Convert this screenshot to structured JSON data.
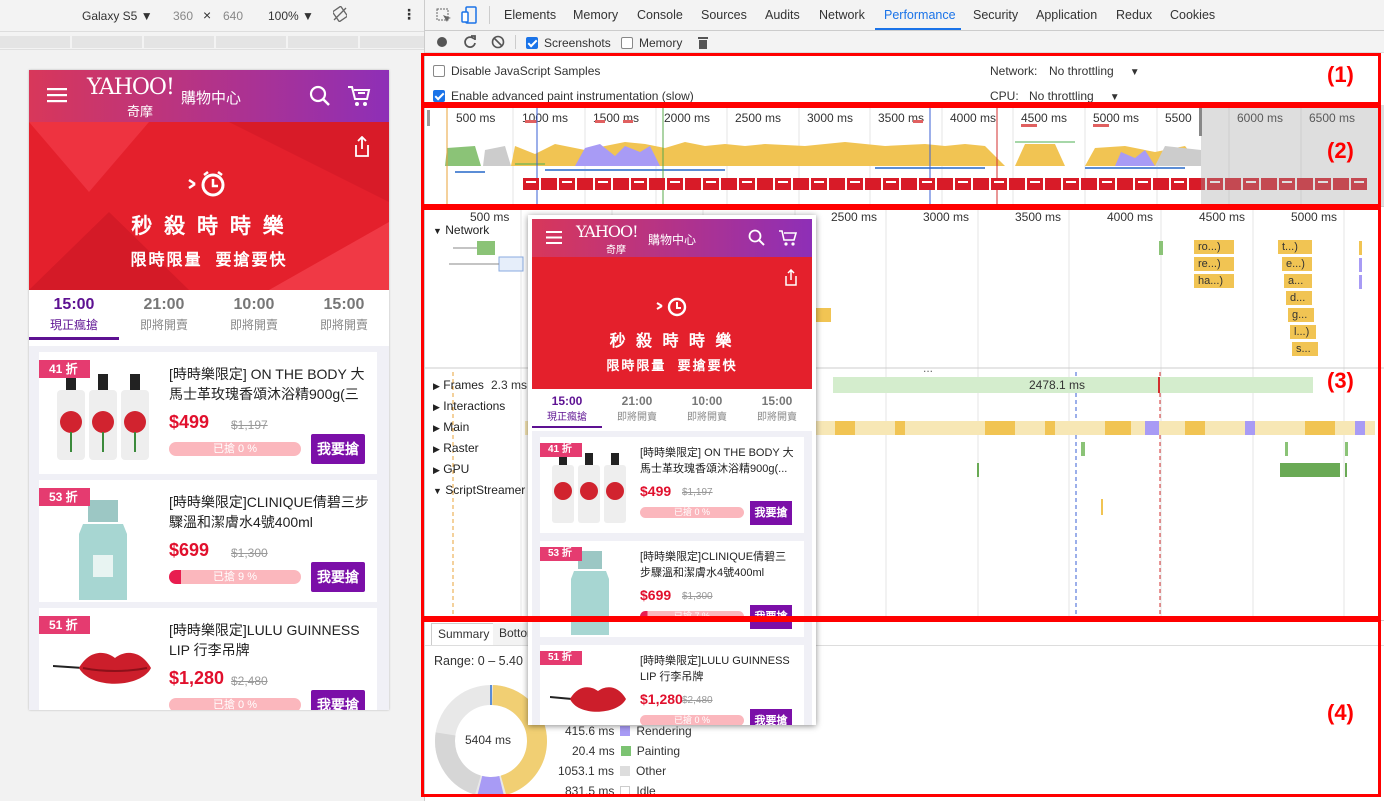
{
  "device_toolbar": {
    "device": "Galaxy S5 ▼",
    "width": "360",
    "x": "×",
    "height": "640",
    "zoom": "100% ▼"
  },
  "devtools_tabs": [
    "Elements",
    "Memory",
    "Console",
    "Sources",
    "Audits",
    "Network",
    "Performance",
    "Security",
    "Application",
    "Redux",
    "Cookies"
  ],
  "active_tab": "Performance",
  "perf_toolbar": {
    "screenshots_label": "Screenshots",
    "memory_label": "Memory"
  },
  "settings": {
    "disable_js_samples": "Disable JavaScript Samples",
    "advanced_paint": "Enable advanced paint instrumentation (slow)",
    "network_label": "Network:",
    "network_value": "No throttling",
    "cpu_label": "CPU:",
    "cpu_value": "No throttling"
  },
  "overview_ticks": [
    "500 ms",
    "1000 ms",
    "1500 ms",
    "2000 ms",
    "2500 ms",
    "3000 ms",
    "3500 ms",
    "4000 ms",
    "4500 ms",
    "5000 ms",
    "5500",
    "6000 ms",
    "6500 ms"
  ],
  "flame_ticks": [
    "500 ms",
    "1000 ms",
    "1500 ms",
    "2000 ms",
    "2500 ms",
    "3000 ms",
    "3500 ms",
    "4000 ms",
    "4500 ms",
    "5000 ms"
  ],
  "tracks": {
    "network": "Network",
    "frames": "Frames",
    "interactions": "Interactions",
    "main": "Main",
    "raster": "Raster",
    "gpu": "GPU",
    "scriptstreamer": "ScriptStreamer"
  },
  "frames_values": {
    "first": "2.3 ms",
    "second": "2478.1 ms"
  },
  "network_items": [
    "ro...)",
    "re...)",
    "ha...)",
    "t...)",
    "e...)",
    "a...",
    "d...",
    "g...",
    "l...)",
    "s..."
  ],
  "bottom": {
    "tabs": [
      "Summary",
      "Bottom-Up"
    ],
    "range": "Range: 0 – 5.40",
    "donut_total": "5404 ms",
    "legend": [
      {
        "value": "415.6 ms",
        "label": "Rendering",
        "color": "#a89bf5"
      },
      {
        "value": "20.4 ms",
        "label": "Painting",
        "color": "#7cc372"
      },
      {
        "value": "1053.1 ms",
        "label": "Other",
        "color": "#dddddd"
      },
      {
        "value": "831.5 ms",
        "label": "Idle",
        "color": "#ffffff"
      }
    ]
  },
  "annotations": [
    "(1)",
    "(2)",
    "(3)",
    "(4)"
  ],
  "phone": {
    "logo": "YAHOO!",
    "logo_sub": "奇摩",
    "store": "購物中心",
    "banner_title": "秒 殺 時 時 樂",
    "banner_sub": "限時限量  要搶要快",
    "tabs": [
      {
        "time": "15:00",
        "status": "現正瘋搶",
        "active": true
      },
      {
        "time": "21:00",
        "status": "即將開賣"
      },
      {
        "time": "10:00",
        "status": "即將開賣"
      },
      {
        "time": "15:00",
        "status": "即將開賣"
      }
    ],
    "products": [
      {
        "discount": "41 折",
        "title": "[時時樂限定] ON THE BODY 大馬士革玫瑰香頌沐浴精900g(三",
        "price": "$499",
        "orig": "$1,197",
        "sold": "已搶 0 %",
        "buy": "我要搶"
      },
      {
        "discount": "53 折",
        "title": "[時時樂限定]CLINIQUE倩碧三步驟溫和潔膚水4號400ml",
        "price": "$699",
        "orig": "$1,300",
        "sold": "已搶 9 %",
        "buy": "我要搶"
      },
      {
        "discount": "51 折",
        "title": "[時時樂限定]LULU GUINNESS LIP 行李吊牌",
        "price": "$1,280",
        "orig": "$2,480",
        "sold": "已搶 0 %",
        "buy": "我要搶"
      }
    ]
  },
  "popup": {
    "products": [
      {
        "discount": "41 折",
        "title": "[時時樂限定] ON THE BODY 大馬士革玫瑰香頌沐浴精900g(...",
        "price": "$499",
        "orig": "$1,197",
        "sold": "已搶 0 %",
        "buy": "我要搶"
      },
      {
        "discount": "53 折",
        "title": "[時時樂限定]CLINIQUE倩碧三步驟溫和潔膚水4號400ml",
        "price": "$699",
        "orig": "$1,300",
        "sold": "已搶 7 %",
        "buy": "我要搶"
      },
      {
        "discount": "51 折",
        "title": "[時時樂限定]LULU GUINNESS LIP 行李吊牌",
        "price": "$1,280",
        "orig": "$2,480",
        "sold": "已搶 0 %",
        "buy": "我要搶"
      }
    ]
  }
}
